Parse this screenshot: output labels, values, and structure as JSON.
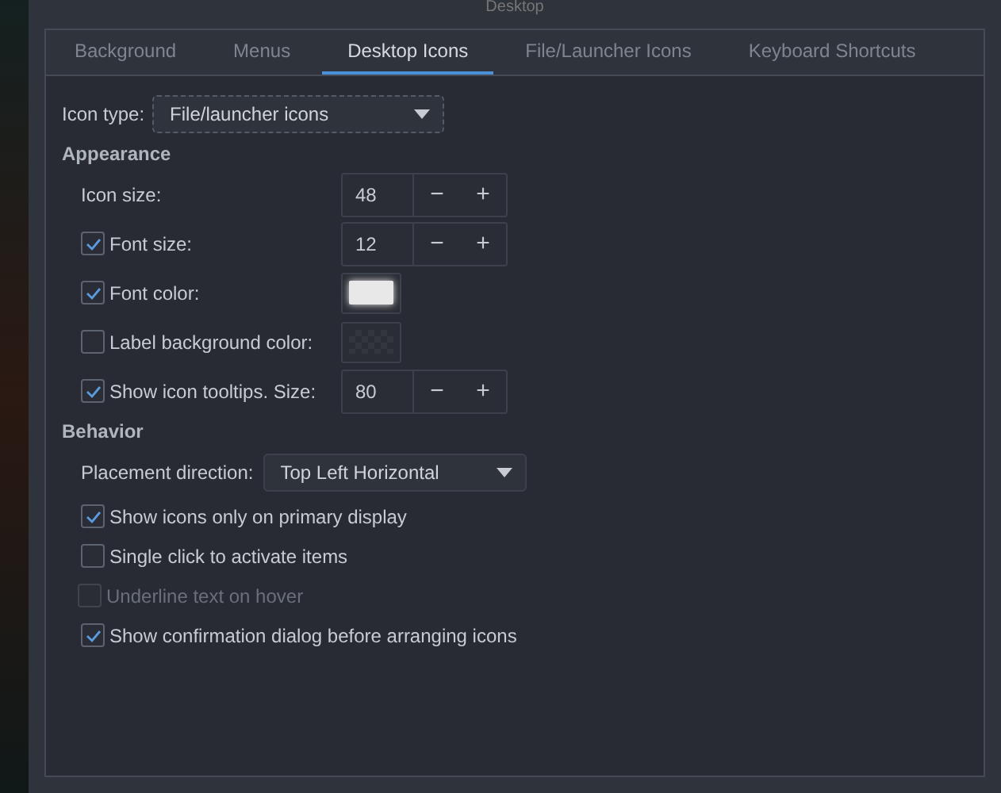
{
  "window": {
    "title": "Desktop"
  },
  "tabs": [
    {
      "label": "Background",
      "selected": false
    },
    {
      "label": "Menus",
      "selected": false
    },
    {
      "label": "Desktop Icons",
      "selected": true
    },
    {
      "label": "File/Launcher Icons",
      "selected": false
    },
    {
      "label": "Keyboard Shortcuts",
      "selected": false
    }
  ],
  "icon_type": {
    "label": "Icon type:",
    "value": "File/launcher icons"
  },
  "appearance": {
    "heading": "Appearance",
    "rows": [
      {
        "kind": "spin",
        "label": "Icon size:",
        "value": "48",
        "minus": "−",
        "plus": "+"
      },
      {
        "kind": "spin",
        "label": "Font size:",
        "checked": true,
        "value": "12",
        "minus": "−",
        "plus": "+"
      },
      {
        "kind": "color",
        "label": "Font color:",
        "checked": true,
        "color": "#e8e8e8"
      },
      {
        "kind": "color",
        "label": "Label background color:",
        "checked": false
      },
      {
        "kind": "spin",
        "label": "Show icon tooltips. Size:",
        "checked": true,
        "value": "80",
        "minus": "−",
        "plus": "+"
      }
    ]
  },
  "behavior": {
    "heading": "Behavior",
    "placement": {
      "label": "Placement direction:",
      "value": "Top Left Horizontal"
    },
    "options": [
      {
        "label": "Show icons only on primary display",
        "checked": true,
        "disabled": false
      },
      {
        "label": "Single click to activate items",
        "checked": false,
        "disabled": false,
        "children": [
          {
            "label": "Underline text on hover",
            "checked": false,
            "disabled": true
          }
        ]
      },
      {
        "label": "Show confirmation dialog before arranging icons",
        "checked": true,
        "disabled": false
      }
    ]
  }
}
